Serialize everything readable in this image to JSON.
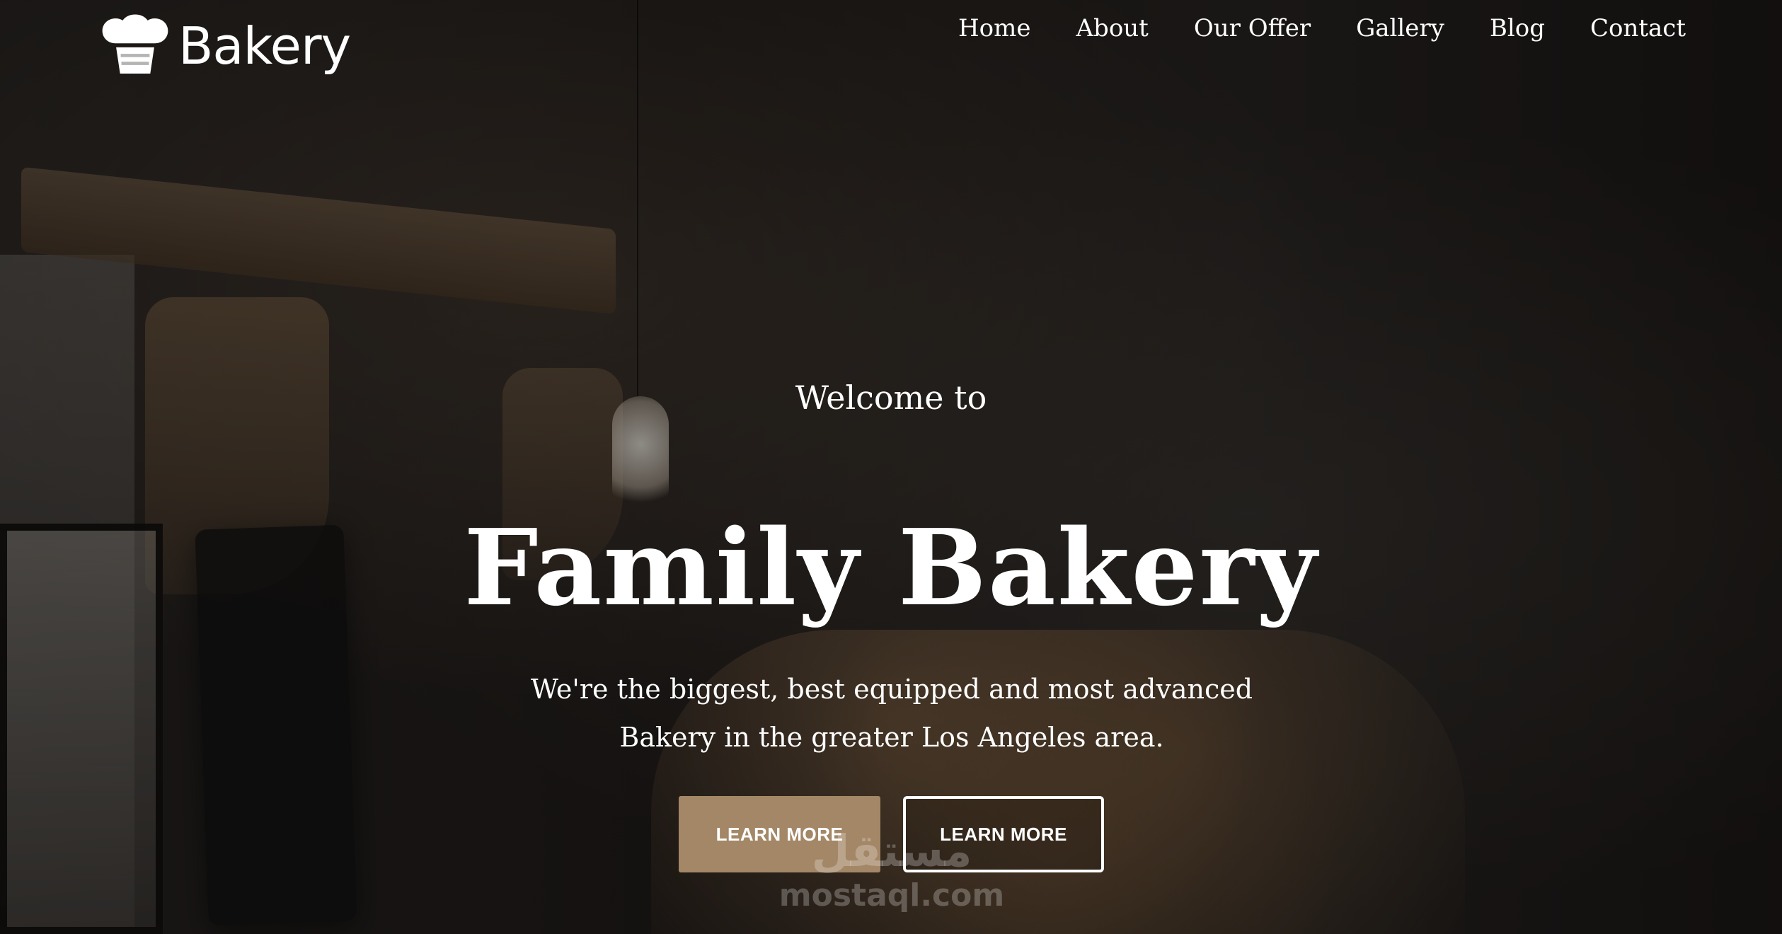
{
  "brand": {
    "name": "Bakery",
    "icon": "chef-hat-icon"
  },
  "nav": {
    "items": [
      {
        "label": "Home"
      },
      {
        "label": "About"
      },
      {
        "label": "Our Offer"
      },
      {
        "label": "Gallery"
      },
      {
        "label": "Blog"
      },
      {
        "label": "Contact"
      }
    ]
  },
  "hero": {
    "welcome": "Welcome to",
    "title": "Family Bakery",
    "subtitle": "We're the biggest, best equipped and most advanced Bakery in the greater Los Angeles area.",
    "buttons": [
      {
        "label": "LEARN MORE",
        "style": "filled"
      },
      {
        "label": "LEARN MORE",
        "style": "outline"
      }
    ]
  },
  "watermark": {
    "arabic": "مستقل",
    "url": "mostaql.com"
  },
  "colors": {
    "accent": "#a38766",
    "text": "#ffffff",
    "overlay": "rgba(0,0,0,0.42)"
  }
}
